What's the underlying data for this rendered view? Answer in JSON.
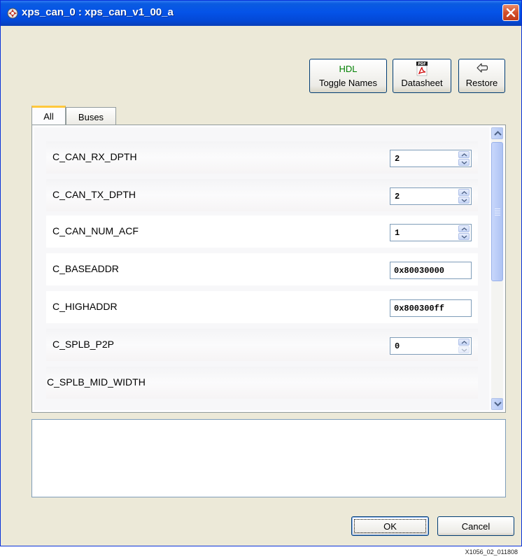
{
  "window": {
    "title": "xps_can_0 : xps_can_v1_00_a",
    "icon": "settings-gear-icon"
  },
  "toolbar": {
    "hdl_label": "HDL",
    "toggle_names_label": "Toggle Names",
    "datasheet_label": "Datasheet",
    "datasheet_icon": "pdf-icon",
    "restore_label": "Restore",
    "restore_icon": "restore-arrow-icon"
  },
  "tabs": [
    {
      "label": "All",
      "active": true
    },
    {
      "label": "Buses",
      "active": false
    }
  ],
  "params": [
    {
      "name": "C_CAN_RX_DPTH",
      "value": "2",
      "control": "spinner"
    },
    {
      "name": "C_CAN_TX_DPTH",
      "value": "2",
      "control": "spinner"
    },
    {
      "name": "C_CAN_NUM_ACF",
      "value": "1",
      "control": "spinner"
    },
    {
      "name": "C_BASEADDR",
      "value": "0x80030000",
      "control": "text"
    },
    {
      "name": "C_HIGHADDR",
      "value": "0x800300ff",
      "control": "text"
    },
    {
      "name": "C_SPLB_P2P",
      "value": "0",
      "control": "spinner"
    },
    {
      "name": "C_SPLB_MID_WIDTH",
      "value": "",
      "control": "none"
    }
  ],
  "description": "",
  "footer": {
    "ok_label": "OK",
    "cancel_label": "Cancel"
  },
  "figure_id": "X1056_02_011808",
  "colors": {
    "titlebar": "#0553e8",
    "dialog_bg": "#ece9d8",
    "close_button": "#d4502a",
    "hdl_text": "#008000",
    "tab_highlight": "#ffc83c"
  }
}
